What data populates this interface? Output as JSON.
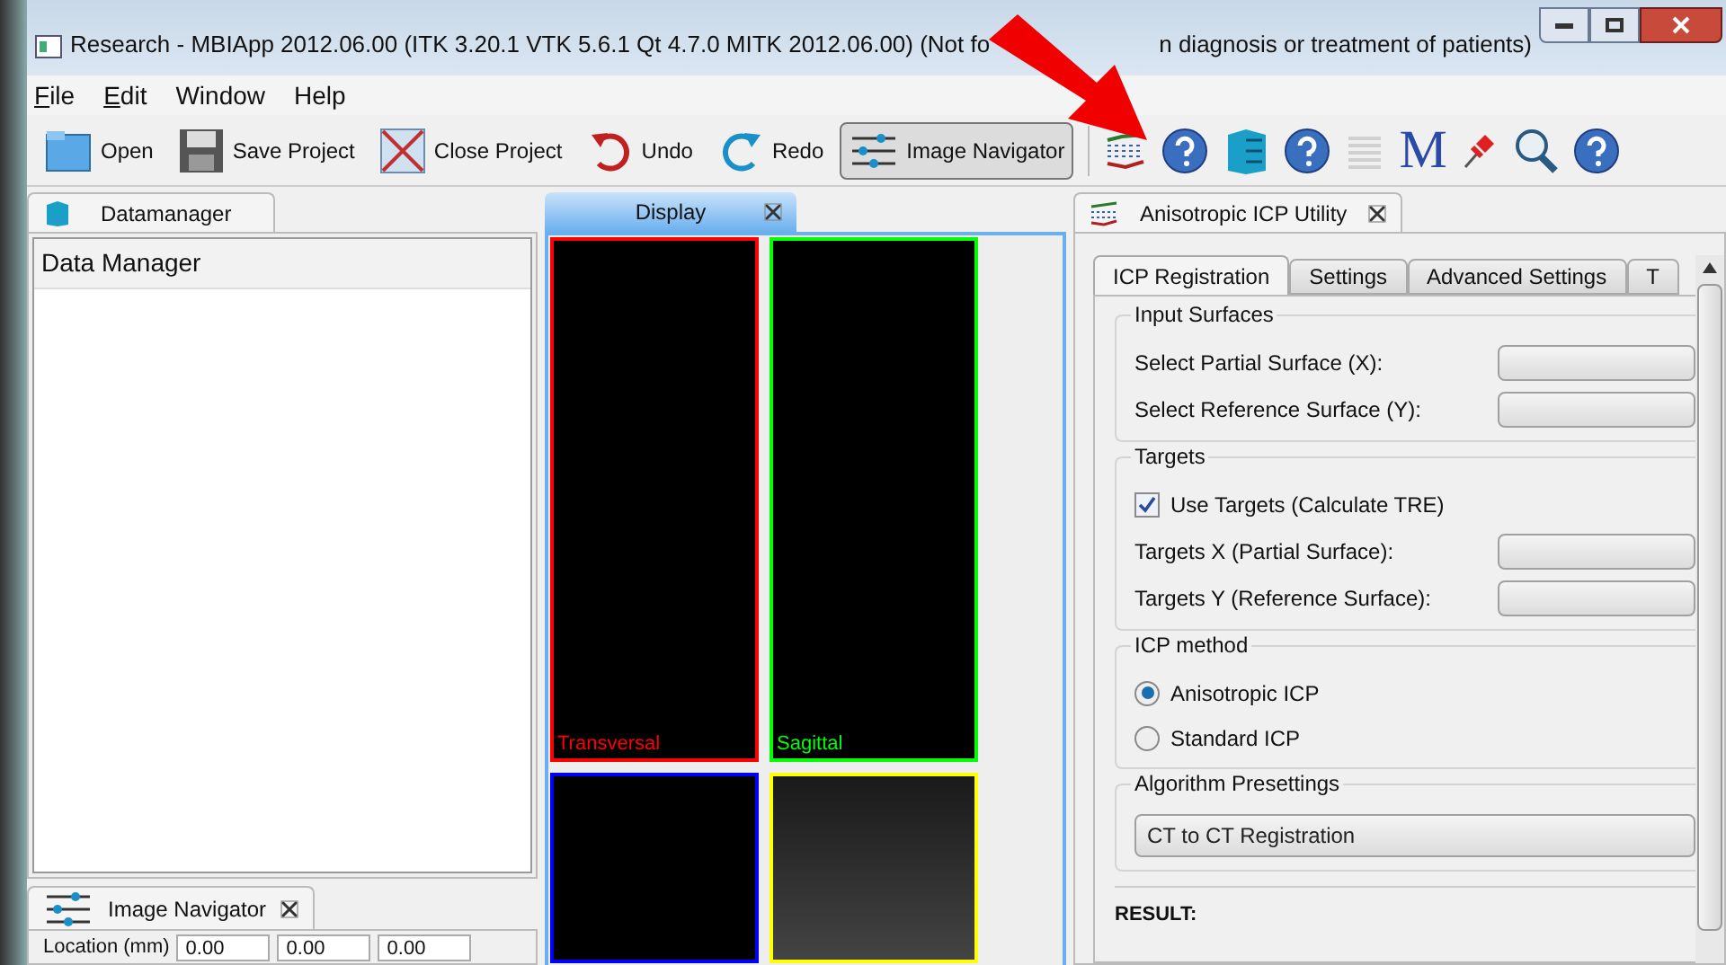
{
  "window": {
    "title_start": "Research - MBIApp 2012.06.00 (ITK 3.20.1  VTK 5.6.1 Qt 4.7.0 MITK 2012.06.00) (Not fo",
    "title_end": "n diagnosis or treatment of patients)"
  },
  "menu": [
    {
      "label": "File",
      "mnemonic": true
    },
    {
      "label": "Edit",
      "mnemonic": true
    },
    {
      "label": "Window",
      "mnemonic": false
    },
    {
      "label": "Help",
      "mnemonic": false
    }
  ],
  "toolbar": [
    {
      "label": "Open",
      "kind": "open",
      "selected": false
    },
    {
      "label": "Save Project",
      "kind": "save",
      "selected": false
    },
    {
      "label": "Close Project",
      "kind": "close",
      "selected": false
    },
    {
      "label": "Undo",
      "kind": "undo",
      "selected": false
    },
    {
      "label": "Redo",
      "kind": "redo",
      "selected": false
    },
    {
      "label": "Image Navigator",
      "kind": "navigator",
      "selected": true
    }
  ],
  "plugin_toolbar": [
    {
      "kind": "icp"
    },
    {
      "kind": "help"
    },
    {
      "kind": "cabinet"
    },
    {
      "kind": "help"
    },
    {
      "kind": "logging"
    },
    {
      "kind": "letter",
      "text": "M"
    },
    {
      "kind": "pin"
    },
    {
      "kind": "magnifier"
    },
    {
      "kind": "help"
    }
  ],
  "datamanager": {
    "tab": "Datamanager",
    "header": "Data Manager"
  },
  "image_navigator": {
    "tab": "Image Navigator",
    "location_label": "Location (mm)",
    "values": [
      "0.00",
      "0.00",
      "0.00"
    ]
  },
  "display": {
    "tab": "Display",
    "views": [
      {
        "label": "Transversal",
        "color": "#ff0000"
      },
      {
        "label": "Sagittal",
        "color": "#00ff00"
      },
      {
        "color": "#0000ff"
      },
      {
        "color": "#ffff00"
      }
    ]
  },
  "icp": {
    "tab": "Anisotropic ICP Utility",
    "subtabs": [
      {
        "label": "ICP Registration",
        "selected": true
      },
      {
        "label": "Settings",
        "selected": false
      },
      {
        "label": "Advanced Settings",
        "selected": false
      },
      {
        "label": "T",
        "selected": false
      }
    ],
    "groups": [
      {
        "title": "Input Surfaces",
        "items": [
          {
            "kind": "combo",
            "label": "Select Partial Surface (X):"
          },
          {
            "kind": "combo",
            "label": "Select Reference Surface (Y):"
          }
        ]
      },
      {
        "title": "Targets",
        "items": [
          {
            "kind": "checkbox",
            "label": "Use Targets (Calculate TRE)",
            "checked": true
          },
          {
            "kind": "combo",
            "label": "Targets X (Partial Surface):"
          },
          {
            "kind": "combo",
            "label": "Targets Y (Reference Surface):"
          }
        ]
      },
      {
        "title": "ICP method",
        "items": [
          {
            "kind": "radio",
            "label": "Anisotropic ICP",
            "selected": true
          },
          {
            "kind": "radio",
            "label": "Standard ICP",
            "selected": false
          }
        ]
      },
      {
        "title": "Algorithm Presettings",
        "items": [
          {
            "kind": "wide_combo",
            "value": "CT to CT Registration"
          }
        ]
      }
    ],
    "result": "RESULT:"
  }
}
